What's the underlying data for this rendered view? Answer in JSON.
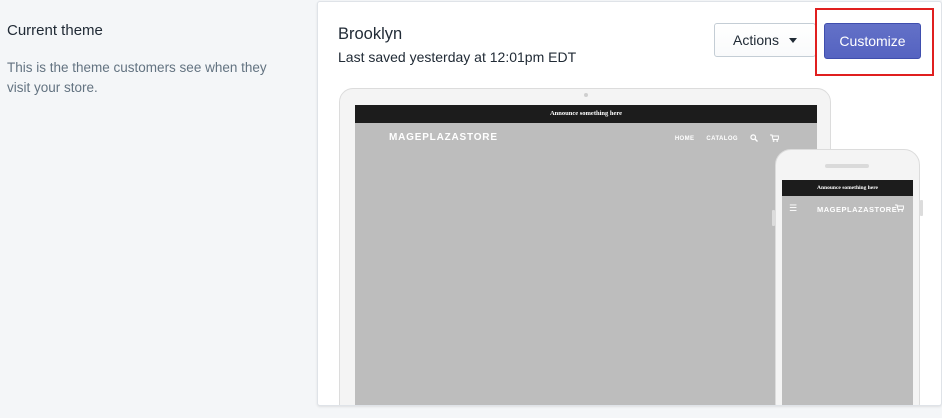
{
  "section": {
    "title": "Current theme",
    "description": "This is the theme customers see when they visit your store."
  },
  "theme": {
    "name": "Brooklyn",
    "saved": "Last saved yesterday at 12:01pm EDT"
  },
  "buttons": {
    "actions_label": "Actions",
    "customize_label": "Customize"
  },
  "preview": {
    "announcement": "Announce something here",
    "store_name": "MAGEPLAZASTORE",
    "nav_links": [
      "HOME",
      "CATALOG"
    ],
    "icons": [
      "search-icon",
      "cart-icon",
      "menu-icon"
    ]
  },
  "colors": {
    "primary": "#5c6ac4",
    "highlight": "#e01f1f",
    "background": "#f4f6f8",
    "preview_gray": "#bdbdbd"
  }
}
